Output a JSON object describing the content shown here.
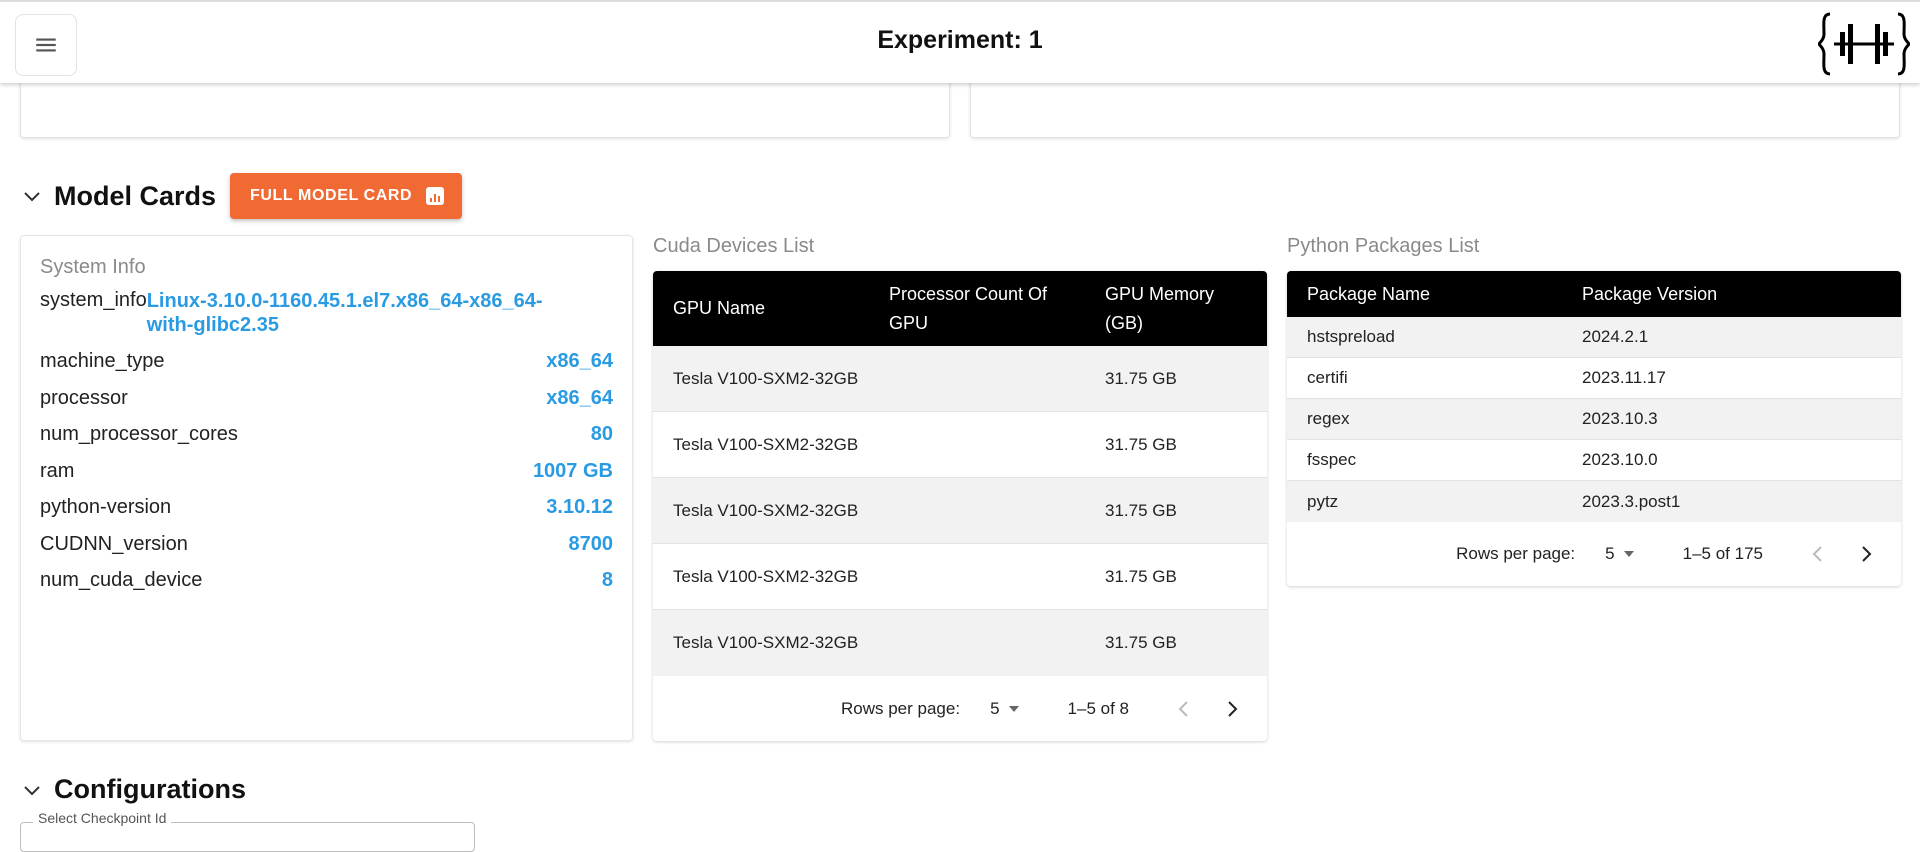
{
  "header": {
    "title": "Experiment: 1",
    "menu_icon": "hamburger-menu-icon",
    "logo_icon": "brand-logo-icon"
  },
  "model_cards": {
    "heading": "Model Cards",
    "full_model_card_button": "FULL MODEL CARD",
    "button_color": "#f26a33"
  },
  "system_info": {
    "title": "System Info",
    "rows": [
      {
        "key": "system_info",
        "value": "Linux-3.10.0-1160.45.1.el7.x86_64-x86_64-with-glibc2.35"
      },
      {
        "key": "machine_type",
        "value": "x86_64"
      },
      {
        "key": "processor",
        "value": "x86_64"
      },
      {
        "key": "num_processor_cores",
        "value": "80"
      },
      {
        "key": "ram",
        "value": "1007 GB"
      },
      {
        "key": "python-version",
        "value": "3.10.12"
      },
      {
        "key": "CUDNN_version",
        "value": "8700"
      },
      {
        "key": "num_cuda_device",
        "value": "8"
      }
    ],
    "value_color": "#2a9be3"
  },
  "cuda_devices": {
    "caption": "Cuda Devices List",
    "columns": [
      "GPU Name",
      "Processor Count Of GPU",
      "GPU Memory (GB)"
    ],
    "rows": [
      [
        "Tesla V100-SXM2-32GB",
        "",
        "31.75 GB"
      ],
      [
        "Tesla V100-SXM2-32GB",
        "",
        "31.75 GB"
      ],
      [
        "Tesla V100-SXM2-32GB",
        "",
        "31.75 GB"
      ],
      [
        "Tesla V100-SXM2-32GB",
        "",
        "31.75 GB"
      ],
      [
        "Tesla V100-SXM2-32GB",
        "",
        "31.75 GB"
      ]
    ],
    "pager": {
      "rows_per_page_label": "Rows per page:",
      "rows_per_page": "5",
      "range": "1–5 of 8"
    }
  },
  "python_packages": {
    "caption": "Python Packages List",
    "columns": [
      "Package Name",
      "Package Version"
    ],
    "rows": [
      [
        "hstspreload",
        "2024.2.1"
      ],
      [
        "certifi",
        "2023.11.17"
      ],
      [
        "regex",
        "2023.10.3"
      ],
      [
        "fsspec",
        "2023.10.0"
      ],
      [
        "pytz",
        "2023.3.post1"
      ]
    ],
    "pager": {
      "rows_per_page_label": "Rows per page:",
      "rows_per_page": "5",
      "range": "1–5 of 175"
    }
  },
  "configurations": {
    "heading": "Configurations",
    "select_label": "Select Checkpoint Id"
  }
}
